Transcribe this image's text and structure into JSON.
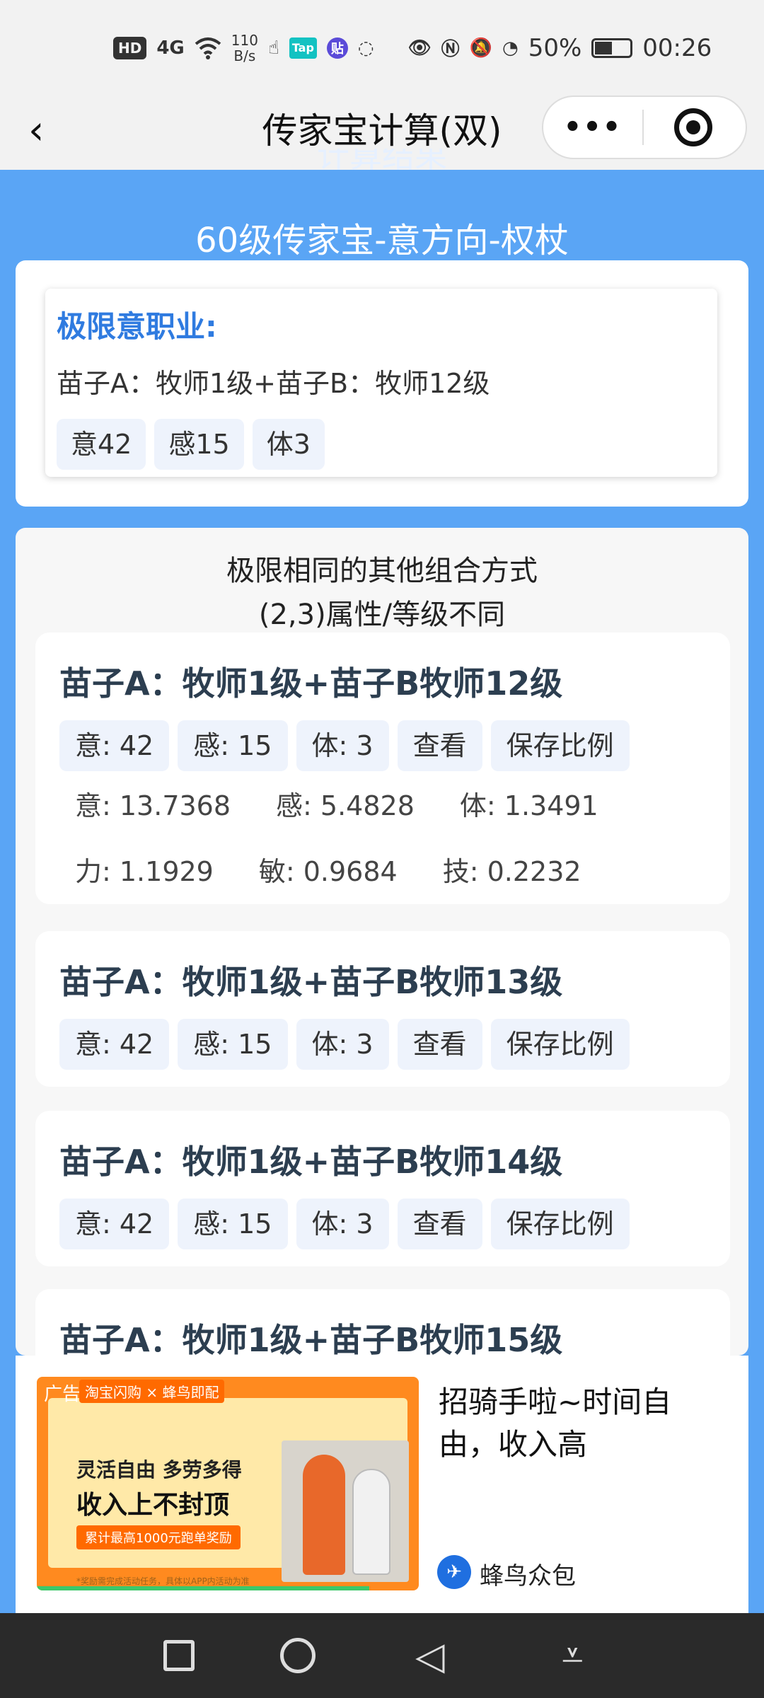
{
  "status_bar": {
    "network": "4G",
    "speed_value": "110",
    "speed_unit": "B/s",
    "tap_label": "Tap",
    "tie_label": "贴",
    "battery_percent": "50%",
    "time": "00:26"
  },
  "nav": {
    "back_icon": "‹",
    "title": "传家宝计算(双)",
    "more_label": "•••"
  },
  "result": {
    "partial_title": "计算结果",
    "heading": "60级传家宝-意方向-权杖",
    "limit_title": "极限意职业:",
    "limit_line": "苗子A：牧师1级+苗子B：牧师12级",
    "tags": [
      "意42",
      "感15",
      "体3"
    ]
  },
  "others": {
    "header_line1": "极限相同的其他组合方式",
    "header_line2": "(2,3)属性/等级不同",
    "combos": [
      {
        "title": "苗子A：牧师1级+苗子B牧师12级",
        "tags": [
          "意: 42",
          "感: 15",
          "体: 3",
          "查看",
          "保存比例"
        ],
        "stats_row1": [
          "意: 13.7368",
          "感: 5.4828",
          "体: 1.3491"
        ],
        "stats_row2": [
          "力: 1.1929",
          "敏: 0.9684",
          "技: 0.2232"
        ]
      },
      {
        "title": "苗子A：牧师1级+苗子B牧师13级",
        "tags": [
          "意: 42",
          "感: 15",
          "体: 3",
          "查看",
          "保存比例"
        ]
      },
      {
        "title": "苗子A：牧师1级+苗子B牧师14级",
        "tags": [
          "意: 42",
          "感: 15",
          "体: 3",
          "查看",
          "保存比例"
        ]
      },
      {
        "title": "苗子A：牧师1级+苗子B牧师15级"
      }
    ]
  },
  "ad": {
    "label": "广告",
    "brand": "淘宝闪购 × 蜂鸟即配",
    "img_line1": "灵活自由 多劳多得",
    "img_line2": "收入上不封顶",
    "img_line3": "累计最高1000元跑单奖励",
    "img_line4": "*奖励需完成活动任务，具体以APP内活动为准",
    "headline": "招骑手啦~时间自由，收入高",
    "source": "蜂鸟众包"
  },
  "system_nav": {
    "back_icon": "◁",
    "menu_icon": "⩡"
  }
}
